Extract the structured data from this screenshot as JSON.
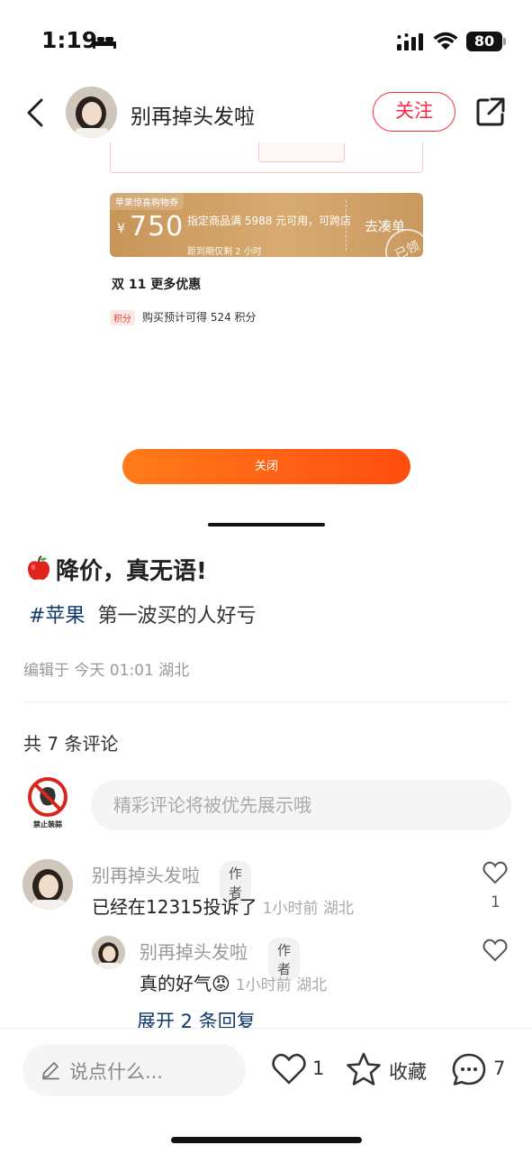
{
  "status_bar": {
    "time": "1:19",
    "battery": "80",
    "icons": [
      "bed-icon",
      "signal-icon",
      "wifi-icon",
      "battery-icon"
    ]
  },
  "nav": {
    "author": "别再掉头发啦",
    "follow_label": "关注",
    "icons": [
      "back-icon",
      "share-icon"
    ]
  },
  "screenshot": {
    "coupon_tag": "苹果惊喜购物券",
    "coupon_currency": "¥",
    "coupon_amount": "750",
    "coupon_condition": "指定商品满 5988 元可用，可跨店",
    "coupon_expire": "距到期仅剩 2 小时",
    "coupon_action": "去凑单",
    "coupon_stamp": "已领",
    "more_deals": "双 11 更多优惠",
    "points_badge": "积分",
    "points_text": "购买预计可得 524 积分",
    "close_label": "关闭"
  },
  "post": {
    "title": "降价，真无语!",
    "hashtag": "#苹果",
    "body": "第一波买的人好亏",
    "meta": "编辑于 今天 01:01 湖北"
  },
  "comments": {
    "count_label": "共 7 条评论",
    "input_placeholder": "精彩评论将被优先展示哦",
    "logo_caption": "禁止装蒜",
    "items": [
      {
        "author": "别再掉头发啦",
        "badge": "作者",
        "text": "已经在12315投诉了",
        "time": "1小时前 湖北",
        "likes": "1"
      },
      {
        "author": "别再掉头发啦",
        "badge": "作者",
        "text": "真的好气",
        "emoji": "😡",
        "time": "1小时前 湖北",
        "likes": ""
      }
    ],
    "expand_label": "展开 2 条回复"
  },
  "bottom_bar": {
    "input_placeholder": "说点什么...",
    "like_count": "1",
    "collect_label": "收藏",
    "comment_count": "7"
  },
  "colors": {
    "brand_red": "#ff2442",
    "tag_blue": "#13386c",
    "coupon_gold": "#c89558",
    "close_orange": "#ff5a12"
  }
}
